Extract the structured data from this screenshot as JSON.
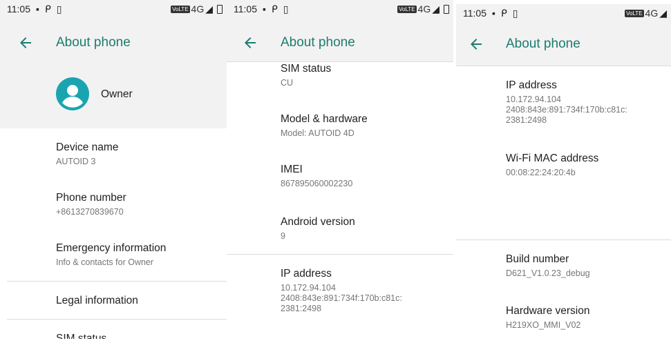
{
  "panels": [
    {
      "status": {
        "time": "11:05",
        "network": "4G",
        "volte": "VoLTE"
      },
      "title": "About phone",
      "owner": "Owner",
      "items": [
        {
          "label": "Device name",
          "summary": "AUTOID 3"
        },
        {
          "label": "Phone number",
          "summary": "+8613270839670"
        },
        {
          "label": "Emergency information",
          "summary": "Info & contacts for Owner"
        },
        {
          "label": "Legal information"
        },
        {
          "label": "SIM status"
        }
      ]
    },
    {
      "status": {
        "time": "11:05",
        "network": "4G",
        "volte": "VoLTE"
      },
      "title": "About phone",
      "items": [
        {
          "label": "SIM status",
          "summary": "CU"
        },
        {
          "label": "Model & hardware",
          "summary": "Model: AUTOID 4D"
        },
        {
          "label": "IMEI",
          "summary": "867895060002230"
        },
        {
          "label": "Android version",
          "summary": "9"
        },
        {
          "label": "IP address",
          "summary": "10.172.94.104\n2408:843e:891:734f:170b:c81c:\n2381:2498"
        }
      ]
    },
    {
      "status": {
        "time": "11:05",
        "network": "4G",
        "volte": "VoLTE"
      },
      "title": "About phone",
      "items": [
        {
          "label": "IP address",
          "summary": "10.172.94.104\n2408:843e:891:734f:170b:c81c:\n2381:2498"
        },
        {
          "label": "Wi-Fi MAC address",
          "summary": "00:08:22:24:20:4b"
        },
        {
          "label": "Build number",
          "summary": "D621_V1.0.23_debug"
        },
        {
          "label": "Hardware version",
          "summary": "H219XO_MMI_V02"
        }
      ]
    }
  ],
  "colors": {
    "accent": "#1a7c6f",
    "avatar": "#1aa4b0"
  }
}
